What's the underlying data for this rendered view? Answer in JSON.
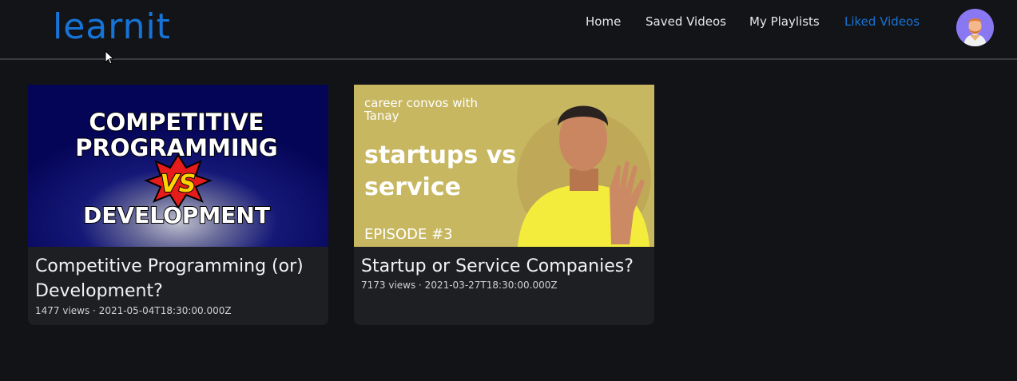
{
  "header": {
    "logo": "learnit",
    "nav": [
      {
        "label": "Home",
        "active": false
      },
      {
        "label": "Saved Videos",
        "active": false
      },
      {
        "label": "My Playlists",
        "active": false
      },
      {
        "label": "Liked Videos",
        "active": true
      }
    ],
    "avatar_icon": "user-avatar-icon"
  },
  "videos": [
    {
      "title": "Competitive Programming (or) Development?",
      "views": "1477 views",
      "date": "2021-05-04T18:30:00.000Z",
      "meta": "1477 views · 2021-05-04T18:30:00.000Z",
      "thumbnail": {
        "line1": "COMPETITIVE",
        "line2": "PROGRAMMING",
        "badge": "VS",
        "line3": "DEVELOPMENT"
      }
    },
    {
      "title": "Startup or Service Companies?",
      "views": "7173 views",
      "date": "2021-03-27T18:30:00.000Z",
      "meta": "7173 views · 2021-03-27T18:30:00.000Z",
      "thumbnail": {
        "caption1": "career convos with",
        "caption2": "Tanay",
        "headline1": "startups vs",
        "headline2": "service",
        "episode": "EPISODE #3"
      }
    }
  ],
  "colors": {
    "background": "#121316",
    "accent": "#1674d8",
    "card": "#1e1f22"
  }
}
